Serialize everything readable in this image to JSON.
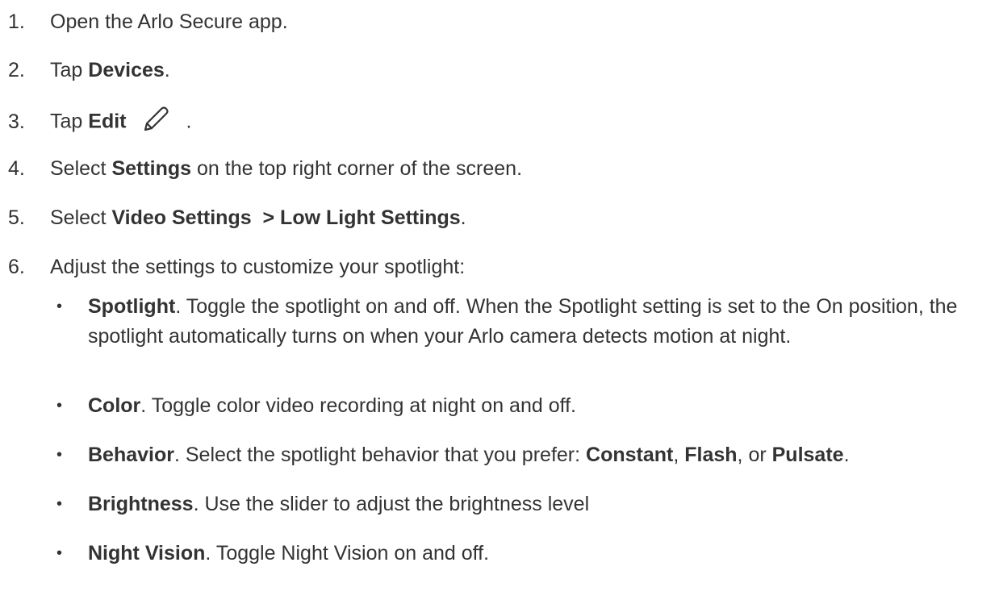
{
  "steps": [
    {
      "num": "1.",
      "pre": "Open the Arlo Secure app.",
      "bold": "",
      "post": ""
    },
    {
      "num": "2.",
      "pre": "Tap ",
      "bold": "Devices",
      "post": "."
    },
    {
      "num": "3.",
      "pre": "Tap ",
      "bold": "Edit",
      "post": "."
    },
    {
      "num": "4.",
      "pre": "Select ",
      "bold": "Settings",
      "post": " on the top right corner of the screen."
    },
    {
      "num": "5.",
      "pre": "Select ",
      "bold": "Video Settings  > Low Light Settings",
      "post": "."
    },
    {
      "num": "6.",
      "pre": "Adjust the settings to customize your spotlight:",
      "bold": "",
      "post": ""
    }
  ],
  "bullets": [
    {
      "bold": "Spotlight",
      "text": ". Toggle the spotlight on and off. When the Spotlight setting is set to the On position, the spotlight automatically turns on when your Arlo camera detects motion at night."
    },
    {
      "bold": "Color",
      "text": ". Toggle color video recording at night on and off."
    },
    {
      "bold": "Behavior",
      "text": ". Select the spotlight behavior that you prefer: ",
      "opt1": "Constant",
      "sep1": ", ",
      "opt2": "Flash",
      "sep2": ", or ",
      "opt3": "Pulsate",
      "end": "."
    },
    {
      "bold": "Brightness",
      "text": ". Use the slider to adjust the brightness level"
    },
    {
      "bold": "Night Vision",
      "text": ". Toggle Night Vision on and off."
    }
  ],
  "bullet_glyph": "•",
  "icons": {
    "edit": "pencil-icon"
  }
}
